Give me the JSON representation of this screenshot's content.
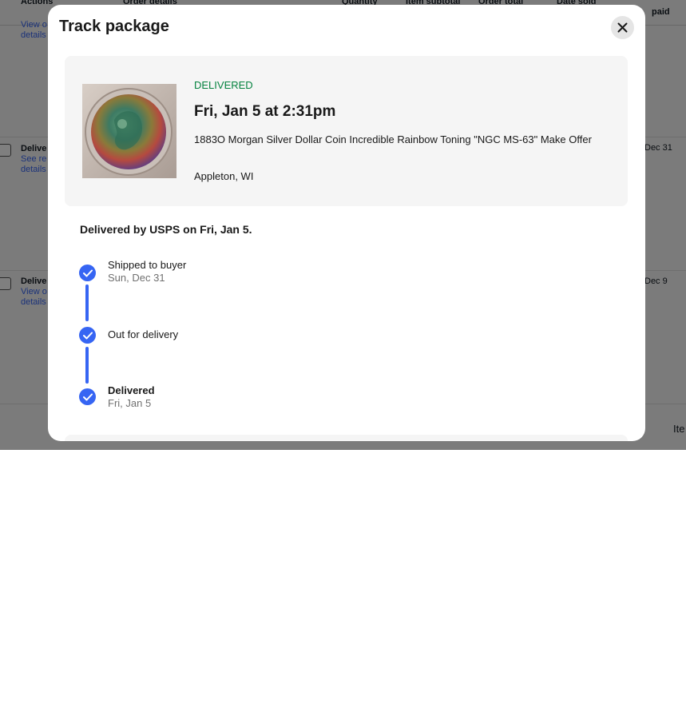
{
  "background": {
    "headers": [
      "Actions",
      "Order details",
      "Quantity",
      "Item subtotal",
      "Order total",
      "Date sold",
      "paid"
    ],
    "rows": [
      {
        "status": "",
        "links": [
          "View o",
          "details"
        ],
        "date": ""
      },
      {
        "status": "Delive",
        "links": [
          "See re",
          "details"
        ],
        "date": "Dec 31"
      },
      {
        "status": "Delive",
        "links": [
          "View o",
          "details"
        ],
        "date": "Dec 9"
      }
    ],
    "footer_text": "Ite"
  },
  "modal": {
    "title": "Track package",
    "close_icon": "close-icon"
  },
  "shipment": {
    "status": "DELIVERED",
    "status_color": "#05823f",
    "datetime": "Fri, Jan 5 at 2:31pm",
    "item_title": "1883O Morgan Silver Dollar Coin Incredible Rainbow Toning \"NGC MS-63\" Make Offer",
    "location": "Appleton, WI"
  },
  "tracking": {
    "summary": "Delivered by USPS on Fri, Jan 5.",
    "accent_color": "#3665f3",
    "steps": [
      {
        "label": "Shipped to buyer",
        "date": "Sun, Dec 31"
      },
      {
        "label": "Out for delivery",
        "date": ""
      },
      {
        "label": "Delivered",
        "date": "Fri, Jan 5"
      }
    ]
  }
}
